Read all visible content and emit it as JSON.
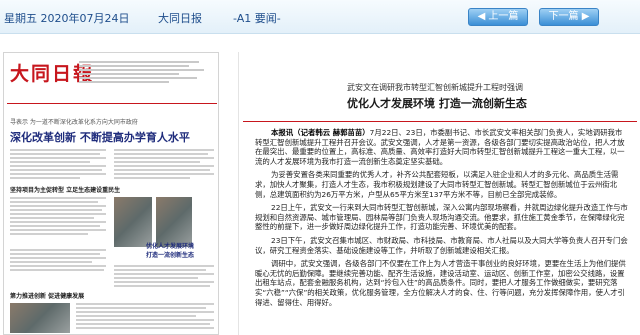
{
  "topbar": {
    "date": "星期五 2020年07月24日",
    "paper": "大同日报",
    "page": "-A1 要闻-",
    "prev_label": "◀ 上一篇",
    "next_label": "下一篇 ▶"
  },
  "thumbnail": {
    "masthead": "大同日報",
    "subhead": "寻表示 为一道不断深化改革化系方向大同市政府",
    "headline": "深化改革创新 不断提高办学育人水平",
    "side_lines": [
      "坚持项目为主促转型 立足生态建设重民生",
      "优化人才发展环境",
      "打造一流创新生态",
      "第力推进创新 促进健康发展"
    ]
  },
  "article": {
    "kicker": "武安文在调研我市转型汇智创新城提升工程时强调",
    "title": "优化人才发展环境 打造一流创新生态",
    "lead": "本报讯（记者韩云 赫郭苗苗）",
    "paragraphs": [
      "7月22日、23日，市委副书记、市长武安文率相关部门负责人，实地调研我市转型汇智创新城提升工程并召开会议。武安文强调，人才是第一资源，各级各部门要切实提高政治站位，把人才放在最突出、最重要的位置上，高标准、高质量、高效率打造好大同市转型汇智创新城提升工程这一重大工程，以一流的人才发展环境为我市打造一流创新生态奠定坚实基础。",
      "为妥善安置各类来同重要的优秀人才，补齐公共配套短板，以满足入驻企业和人才的多元化、高品质生活需求，加快人才聚集，打造人才生态，我市积极规划建设了大同市转型汇智创新城。转型汇智创新城位于云州街北侧，总建筑面积约为26万平方米，户型从65平方米至137平方米不等，目前已全部完成装修。",
      "22日上午，武安文一行来到大同市转型汇智创新城，深入公寓内部现场察看，并就周边绿化提升改造工作与市规划和自然资源局、城市管理局、园林局等部门负责人现场沟通交流。他要求，抓住施工黄金季节，在保障绿化完整性的前提下，进一步做好周边绿化提升工作，打造功能完善、环境优美的配套。",
      "23日下午，武安文召集市城区、市财政局、市科技局、市教育局、市人社局以及大同大学等负责人召开专门会议，研究工程资金落实、基础设施建设等工作，并听取了创新城建设相关汇报。",
      "调研中，武安文强调，各级各部门不仅要在工作上为人才营造干事创业的良好环境，更要在生活上为他们提供暖心无忧的后勤保障。要继续完善功能、配齐生活设施，建设活动室、运动区、创新工作室，加密公交线路，设置出租车站点，配套金融服务机构，达到“拎包入住”的高品质条件。同时，要把人才服务工作做细做实，要研究落实“六稳”“六保”的相关政策，优化服务管理，全方位解决人才的食、住、行等问题，充分发挥保障作用，使人才引得进、留得住、用得好。"
    ]
  }
}
